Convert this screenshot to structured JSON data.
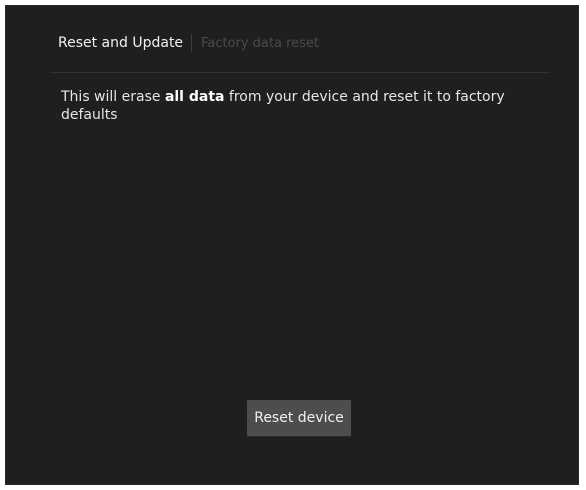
{
  "header": {
    "parent_title": "Reset and Update",
    "current_title": "Factory data reset"
  },
  "message": {
    "before": "This will erase ",
    "bold": "all data",
    "after": " from your device and reset it to factory defaults"
  },
  "actions": {
    "reset_label": "Reset device"
  }
}
